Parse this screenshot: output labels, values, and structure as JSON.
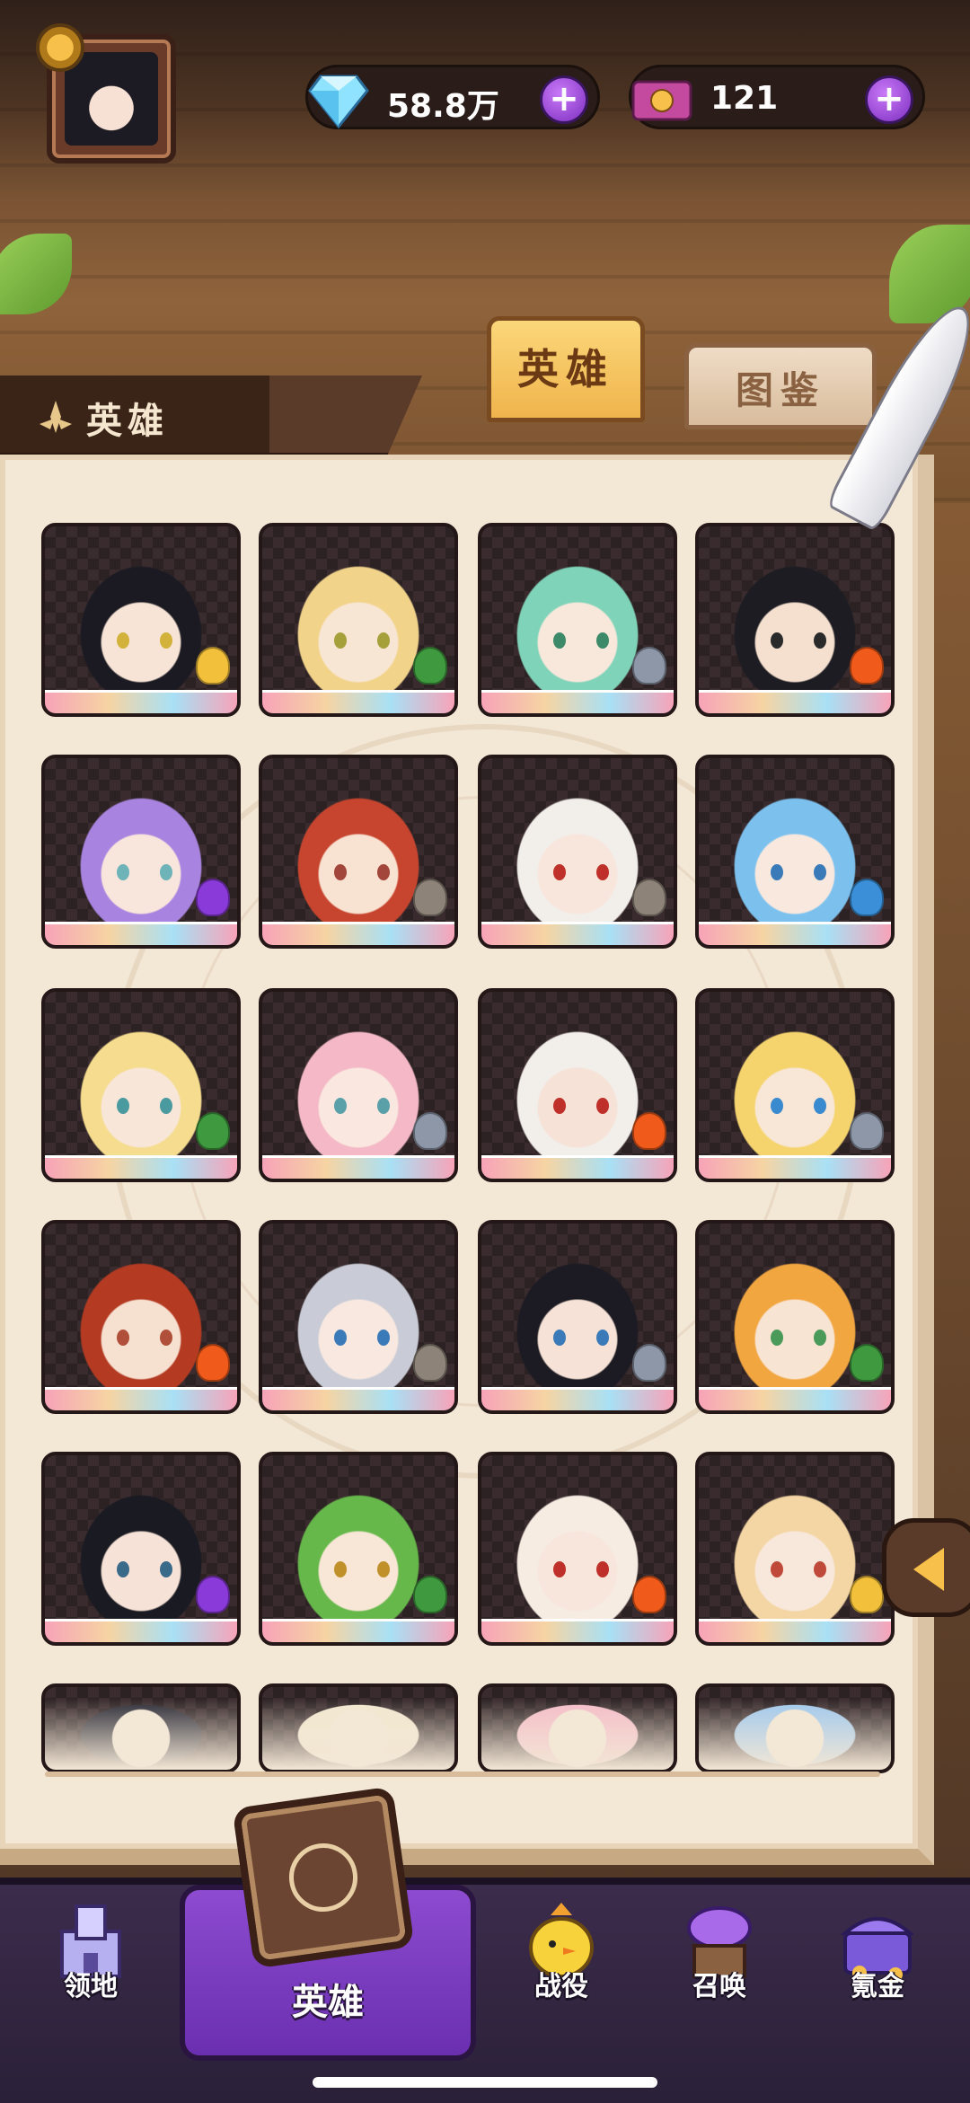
{
  "header": {
    "diamond_value": "58.8万",
    "ticket_value": "121"
  },
  "tabs": [
    {
      "label": "英雄",
      "active": true
    },
    {
      "label": "图鉴",
      "active": false
    }
  ],
  "section": {
    "title": "英雄"
  },
  "heroes": [
    {
      "hair": "#1b1a22",
      "skin": "#f7e4d6",
      "eye": "#d2b23a",
      "elem": "#f2c03a"
    },
    {
      "hair": "#f2d38a",
      "skin": "#f8e6d5",
      "eye": "#a6a03a",
      "elem": "#3f9a3f"
    },
    {
      "hair": "#7fd3b8",
      "skin": "#f8e8dc",
      "eye": "#3d8a6a",
      "elem": "#8d97a8"
    },
    {
      "hair": "#1c1c22",
      "skin": "#f5e0d0",
      "eye": "#2a2a2a",
      "elem": "#f05a1a"
    },
    {
      "hair": "#a983e0",
      "skin": "#f8e6dc",
      "eye": "#6db3b8",
      "elem": "#8a3ad8"
    },
    {
      "hair": "#c7452e",
      "skin": "#f8e2d2",
      "eye": "#a2453a",
      "elem": "#8d8378"
    },
    {
      "hair": "#f2eeea",
      "skin": "#f8e6dc",
      "eye": "#c0302a",
      "elem": "#8d8378"
    },
    {
      "hair": "#7cc1ee",
      "skin": "#f8e8de",
      "eye": "#3a7ab8",
      "elem": "#3a8fd8"
    },
    {
      "hair": "#f5dc8e",
      "skin": "#f8e6d8",
      "eye": "#4a9aa0",
      "elem": "#3f9a3f"
    },
    {
      "hair": "#f4b8c6",
      "skin": "#fae8e0",
      "eye": "#5aa0a8",
      "elem": "#8d97a8"
    },
    {
      "hair": "#f2eeea",
      "skin": "#f6e2d6",
      "eye": "#c0302a",
      "elem": "#f05a1a"
    },
    {
      "hair": "#f5d46e",
      "skin": "#f8e6d6",
      "eye": "#3a8ad0",
      "elem": "#8d97a8"
    },
    {
      "hair": "#b43a22",
      "skin": "#f6e0d0",
      "eye": "#b0503a",
      "elem": "#f05a1a"
    },
    {
      "hair": "#c9ccd6",
      "skin": "#f8e8e0",
      "eye": "#3a7ab8",
      "elem": "#8d8378"
    },
    {
      "hair": "#1c1a22",
      "skin": "#f6e2d6",
      "eye": "#3a7ab8",
      "elem": "#8d97a8"
    },
    {
      "hair": "#f2a640",
      "skin": "#f8e4d2",
      "eye": "#4a9a5a",
      "elem": "#3f9a3f"
    },
    {
      "hair": "#1a1a22",
      "skin": "#f6e2d6",
      "eye": "#3a6a8a",
      "elem": "#8a3ad8"
    },
    {
      "hair": "#66b84a",
      "skin": "#f8e6d6",
      "eye": "#c0902a",
      "elem": "#3f9a3f"
    },
    {
      "hair": "#f6ece2",
      "skin": "#f8e6dc",
      "eye": "#c0302a",
      "elem": "#f05a1a"
    },
    {
      "hair": "#f4d6a4",
      "skin": "#f8e8dc",
      "eye": "#c04a3a",
      "elem": "#f2c03a"
    },
    {
      "hair": "#2a2a36",
      "skin": "#f3e7d6",
      "eye": "#f3e7d6",
      "elem": "#8a3ad8"
    },
    {
      "hair": "#f2e8d0",
      "skin": "#f3e7d6",
      "eye": "#f3e7d6",
      "elem": "#f2c03a"
    },
    {
      "hair": "#f4bcc8",
      "skin": "#f3e7d6",
      "eye": "#f3e7d6",
      "elem": "#e04040"
    },
    {
      "hair": "#9ec8ee",
      "skin": "#f3e7d6",
      "eye": "#f3e7d6",
      "elem": "#e04040"
    }
  ],
  "nav": [
    {
      "label": "领地",
      "icon": "castle-icon"
    },
    {
      "label": "英雄",
      "icon": "hero-book-icon",
      "active": true
    },
    {
      "label": "战役",
      "icon": "chick-warrior-icon"
    },
    {
      "label": "召唤",
      "icon": "summon-altar-icon"
    },
    {
      "label": "氪金",
      "icon": "treasure-chest-icon"
    }
  ],
  "colors": {
    "accent_purple": "#7c2fc0",
    "tab_active": "#f0b44c",
    "page_bg": "#f3e7d6"
  }
}
